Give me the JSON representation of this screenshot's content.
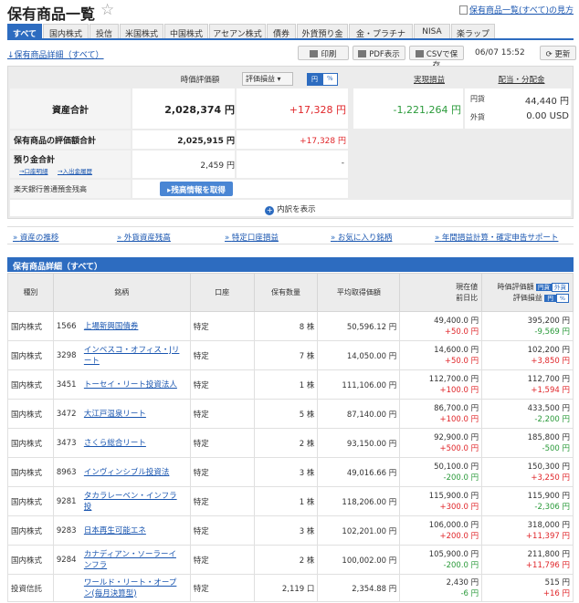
{
  "title": "保有商品一覧",
  "help_link": "保有商品一覧(すべて)の見方",
  "tabs": [
    "すべて",
    "国内株式",
    "投信",
    "米国株式",
    "中国株式",
    "アセアン株式",
    "債券",
    "外貨預り金",
    "金・プラチナ",
    "NISA",
    "楽ラップ"
  ],
  "toolbar": {
    "back_link": "↓保有商品詳細（すべて）",
    "print": "印刷",
    "pdf": "PDF表示",
    "csv": "CSVで保存",
    "timestamp": "06/07 15:52",
    "refresh": "更新"
  },
  "summary": {
    "col_valuation": "時価評価額",
    "col_gainloss_select": "評価損益",
    "toggle_yen": "円",
    "toggle_pct": "%",
    "col_realized": "実現損益",
    "col_dividend": "配当・分配金",
    "total_label": "資産合計",
    "total_value": "2,028,374 円",
    "total_gain": "+17,328 円",
    "realized_value": "-1,221,264 円",
    "div_yen_label": "円貨",
    "div_yen_value": "44,440 円",
    "div_fx_label": "外貨",
    "div_fx_value": "0.00 USD",
    "holdings_label": "保有商品の評価額合計",
    "holdings_value": "2,025,915 円",
    "holdings_gain": "+17,328 円",
    "deposit_label": "預り金合計",
    "deposit_sub1": "→口座明細",
    "deposit_sub2": "→入出金履歴",
    "deposit_value": "2,459 円",
    "deposit_gain": "-",
    "bank_label": "楽天銀行普通預金残高",
    "bank_button": "残高情報を取得",
    "breakdown": "内訳を表示"
  },
  "links": [
    "資産の推移",
    "外貨資産残高",
    "特定口座損益",
    "お気に入り銘柄",
    "年間損益計算・確定申告サポート"
  ],
  "section_title": "保有商品詳細（すべて）",
  "table": {
    "headers": {
      "type": "種別",
      "name": "銘柄",
      "account": "口座",
      "qty": "保有数量",
      "avg": "平均取得価額",
      "price1": "現在値",
      "price2": "前日比",
      "val1": "時価評価額",
      "val2": "評価損益",
      "t_yen": "円貨",
      "t_fx": "外貨",
      "t2_yen": "円",
      "t2_pct": "%"
    },
    "rows": [
      {
        "type": "国内株式",
        "code": "1566",
        "name": "上場新興国債券",
        "account": "特定",
        "qty": "8 株",
        "avg": "50,596.12 円",
        "price": "49,400.0 円",
        "change": "+50.0 円",
        "value": "395,200 円",
        "gain": "-9,569 円",
        "cc": "red",
        "gc": "green"
      },
      {
        "type": "国内株式",
        "code": "3298",
        "name": "インベスコ・オフィス・Jリート",
        "account": "特定",
        "qty": "7 株",
        "avg": "14,050.00 円",
        "price": "14,600.0 円",
        "change": "+50.0 円",
        "value": "102,200 円",
        "gain": "+3,850 円",
        "cc": "red",
        "gc": "red"
      },
      {
        "type": "国内株式",
        "code": "3451",
        "name": "トーセイ・リート投資法人",
        "account": "特定",
        "qty": "1 株",
        "avg": "111,106.00 円",
        "price": "112,700.0 円",
        "change": "+100.0 円",
        "value": "112,700 円",
        "gain": "+1,594 円",
        "cc": "red",
        "gc": "red"
      },
      {
        "type": "国内株式",
        "code": "3472",
        "name": "大江戸温泉リート",
        "account": "特定",
        "qty": "5 株",
        "avg": "87,140.00 円",
        "price": "86,700.0 円",
        "change": "+100.0 円",
        "value": "433,500 円",
        "gain": "-2,200 円",
        "cc": "red",
        "gc": "green"
      },
      {
        "type": "国内株式",
        "code": "3473",
        "name": "さくら総合リート",
        "account": "特定",
        "qty": "2 株",
        "avg": "93,150.00 円",
        "price": "92,900.0 円",
        "change": "+500.0 円",
        "value": "185,800 円",
        "gain": "-500 円",
        "cc": "red",
        "gc": "green"
      },
      {
        "type": "国内株式",
        "code": "8963",
        "name": "インヴィンシブル投資法",
        "account": "特定",
        "qty": "3 株",
        "avg": "49,016.66 円",
        "price": "50,100.0 円",
        "change": "-200.0 円",
        "value": "150,300 円",
        "gain": "+3,250 円",
        "cc": "green",
        "gc": "red"
      },
      {
        "type": "国内株式",
        "code": "9281",
        "name": "タカラレーベン・インフラ投",
        "account": "特定",
        "qty": "1 株",
        "avg": "118,206.00 円",
        "price": "115,900.0 円",
        "change": "+300.0 円",
        "value": "115,900 円",
        "gain": "-2,306 円",
        "cc": "red",
        "gc": "green"
      },
      {
        "type": "国内株式",
        "code": "9283",
        "name": "日本再生可能エネ",
        "account": "特定",
        "qty": "3 株",
        "avg": "102,201.00 円",
        "price": "106,000.0 円",
        "change": "+200.0 円",
        "value": "318,000 円",
        "gain": "+11,397 円",
        "cc": "red",
        "gc": "red"
      },
      {
        "type": "国内株式",
        "code": "9284",
        "name": "カナディアン・ソーラーインフラ",
        "account": "特定",
        "qty": "2 株",
        "avg": "100,002.00 円",
        "price": "105,900.0 円",
        "change": "-200.0 円",
        "value": "211,800 円",
        "gain": "+11,796 円",
        "cc": "green",
        "gc": "red"
      },
      {
        "type": "投資信託",
        "code": "",
        "name": "ワールド・リート・オープン(毎月決算型)",
        "account": "特定",
        "qty": "2,119 口",
        "avg": "2,354.88 円",
        "price": "2,430 円",
        "change": "-6 円",
        "value": "515 円",
        "gain": "+16 円",
        "cc": "green",
        "gc": "red"
      }
    ]
  },
  "colors": {
    "accent": "#2d6cc0",
    "positive": "#e0262a",
    "negative": "#2a9a3a"
  }
}
